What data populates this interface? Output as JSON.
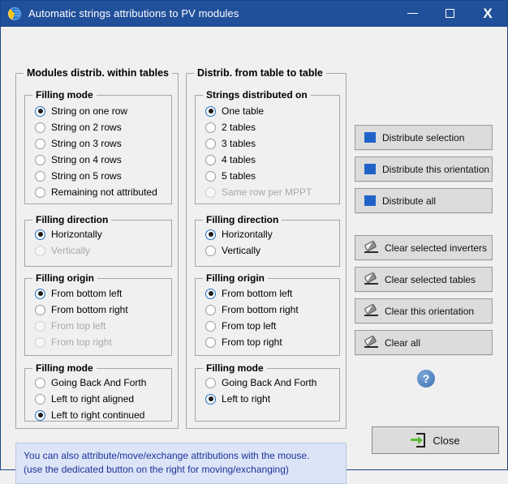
{
  "window": {
    "title": "Automatic strings attributions to PV modules",
    "app_icon": "globe-icon",
    "minimize_label": "minimize-icon",
    "maximize_label": "maximize-icon",
    "close_label": "X"
  },
  "left_panel": {
    "title": "Modules distrib. within tables",
    "groups": [
      {
        "title": "Filling mode",
        "options": [
          {
            "label": "String on one row",
            "selected": true,
            "disabled": false
          },
          {
            "label": "String on 2 rows",
            "selected": false,
            "disabled": false
          },
          {
            "label": "String on 3 rows",
            "selected": false,
            "disabled": false
          },
          {
            "label": "String on 4 rows",
            "selected": false,
            "disabled": false
          },
          {
            "label": "String on 5 rows",
            "selected": false,
            "disabled": false
          },
          {
            "label": "Remaining not attributed",
            "selected": false,
            "disabled": false
          }
        ]
      },
      {
        "title": "Filling direction",
        "options": [
          {
            "label": "Horizontally",
            "selected": true,
            "disabled": false
          },
          {
            "label": "Vertically",
            "selected": false,
            "disabled": true
          }
        ]
      },
      {
        "title": "Filling origin",
        "options": [
          {
            "label": "From bottom left",
            "selected": true,
            "disabled": false
          },
          {
            "label": "From bottom right",
            "selected": false,
            "disabled": false
          },
          {
            "label": "From top left",
            "selected": false,
            "disabled": true
          },
          {
            "label": "From top right",
            "selected": false,
            "disabled": true
          }
        ]
      },
      {
        "title": "Filling mode",
        "options": [
          {
            "label": "Going Back And Forth",
            "selected": false,
            "disabled": false
          },
          {
            "label": "Left to right aligned",
            "selected": false,
            "disabled": false
          },
          {
            "label": "Left to right continued",
            "selected": true,
            "disabled": false
          }
        ]
      }
    ]
  },
  "middle_panel": {
    "title": "Distrib. from table to table",
    "groups": [
      {
        "title": "Strings distributed on",
        "options": [
          {
            "label": "One table",
            "selected": true,
            "disabled": false
          },
          {
            "label": "2 tables",
            "selected": false,
            "disabled": false
          },
          {
            "label": "3 tables",
            "selected": false,
            "disabled": false
          },
          {
            "label": "4 tables",
            "selected": false,
            "disabled": false
          },
          {
            "label": "5 tables",
            "selected": false,
            "disabled": false
          },
          {
            "label": "Same row per MPPT",
            "selected": false,
            "disabled": true
          }
        ]
      },
      {
        "title": "Filling direction",
        "options": [
          {
            "label": "Horizontally",
            "selected": true,
            "disabled": false
          },
          {
            "label": "Vertically",
            "selected": false,
            "disabled": false
          }
        ]
      },
      {
        "title": "Filling origin",
        "options": [
          {
            "label": "From bottom left",
            "selected": true,
            "disabled": false
          },
          {
            "label": "From bottom right",
            "selected": false,
            "disabled": false
          },
          {
            "label": "From top left",
            "selected": false,
            "disabled": false
          },
          {
            "label": "From top right",
            "selected": false,
            "disabled": false
          }
        ]
      },
      {
        "title": "Filling mode",
        "options": [
          {
            "label": "Going Back And Forth",
            "selected": false,
            "disabled": false
          },
          {
            "label": "Left to right",
            "selected": true,
            "disabled": false
          }
        ]
      }
    ]
  },
  "actions": {
    "distribute": [
      {
        "label": "Distribute selection",
        "icon": "grid-icon"
      },
      {
        "label": "Distribute this orientation",
        "icon": "grid-icon"
      },
      {
        "label": "Distribute all",
        "icon": "grid-icon"
      }
    ],
    "clear": [
      {
        "label": "Clear selected inverters",
        "icon": "eraser-icon"
      },
      {
        "label": "Clear selected tables",
        "icon": "eraser-icon"
      },
      {
        "label": "Clear this orientation",
        "icon": "eraser-icon"
      },
      {
        "label": "Clear all",
        "icon": "eraser-icon"
      }
    ],
    "help": {
      "label": "?",
      "icon": "help-icon"
    }
  },
  "info": {
    "line1": "You can also attribute/move/exchange attributions with the mouse.",
    "line2": "(use the dedicated button on the right for moving/exchanging)"
  },
  "footer": {
    "close_label": "Close",
    "close_icon": "exit-icon"
  },
  "colors": {
    "titlebar": "#21509b",
    "accent_radio": "#1b6fc4",
    "info_bg": "#dbe5f7",
    "info_text": "#20309a",
    "button_face": "#dcdcdc",
    "icon_grid_border": "#1f63c8",
    "icon_grid_cyan": "#3ad6e8",
    "icon_grid_pink": "#f58bb0",
    "icon_grid_yellow": "#f2ef3e",
    "exit_arrow": "#5dbb36"
  }
}
